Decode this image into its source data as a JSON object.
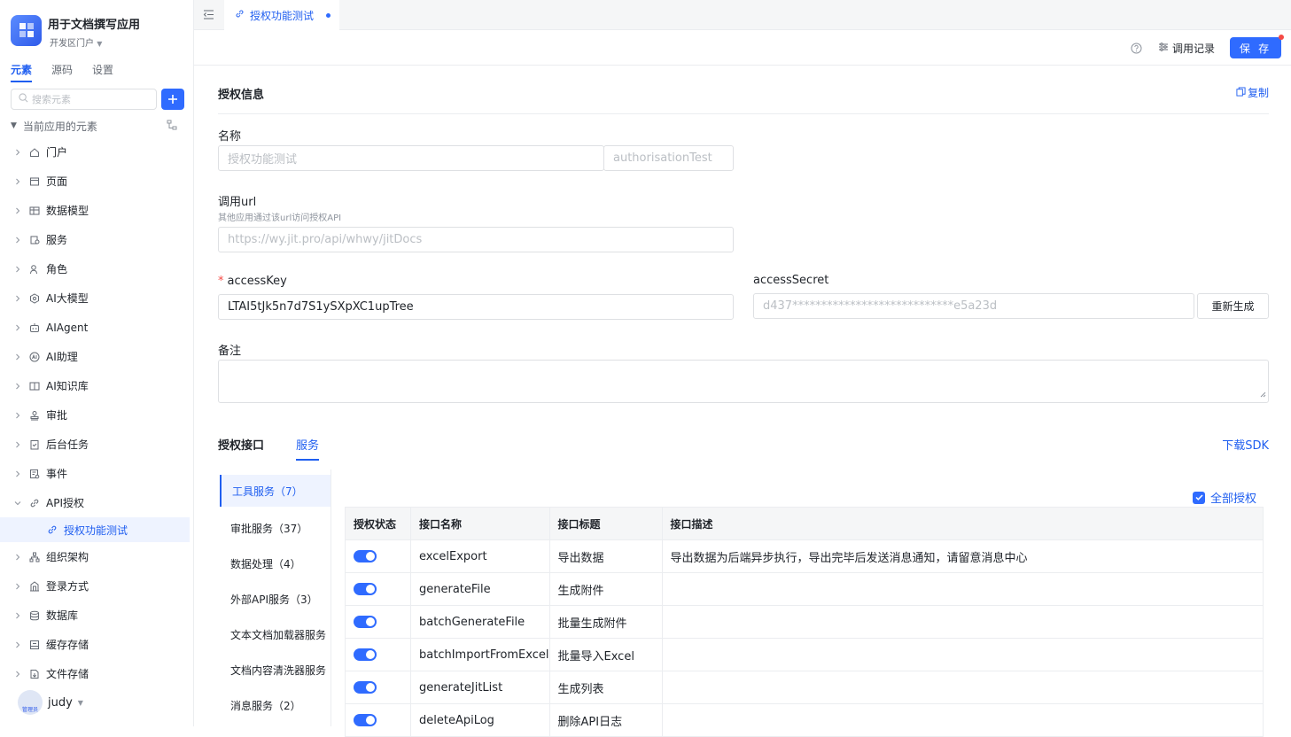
{
  "app": {
    "title": "用于文档撰写应用",
    "subtitle": "开发区门户"
  },
  "sidebar": {
    "tabs": [
      {
        "label": "元素"
      },
      {
        "label": "源码"
      },
      {
        "label": "设置"
      }
    ],
    "search_placeholder": "搜索元素",
    "group_label": "当前应用的元素",
    "items": [
      {
        "label": "门户",
        "icon": "home-icon"
      },
      {
        "label": "页面",
        "icon": "page-icon"
      },
      {
        "label": "数据模型",
        "icon": "table-icon"
      },
      {
        "label": "服务",
        "icon": "service-icon"
      },
      {
        "label": "角色",
        "icon": "role-icon"
      },
      {
        "label": "AI大模型",
        "icon": "ai-model-icon"
      },
      {
        "label": "AIAgent",
        "icon": "robot-icon"
      },
      {
        "label": "AI助理",
        "icon": "ai-assistant-icon"
      },
      {
        "label": "AI知识库",
        "icon": "book-icon"
      },
      {
        "label": "审批",
        "icon": "stamp-icon"
      },
      {
        "label": "后台任务",
        "icon": "task-icon"
      },
      {
        "label": "事件",
        "icon": "event-icon"
      },
      {
        "label": "API授权",
        "icon": "link-icon"
      }
    ],
    "active_sub": {
      "label": "授权功能测试",
      "icon": "link-icon"
    },
    "items_after": [
      {
        "label": "组织架构",
        "icon": "org-icon"
      },
      {
        "label": "登录方式",
        "icon": "login-icon"
      },
      {
        "label": "数据库",
        "icon": "database-icon"
      },
      {
        "label": "缓存存储",
        "icon": "cache-icon"
      },
      {
        "label": "文件存储",
        "icon": "file-icon"
      }
    ],
    "user": {
      "name": "judy",
      "role": "管理员"
    }
  },
  "tab": {
    "label": "授权功能测试"
  },
  "toolbar": {
    "log_label": "调用记录",
    "save_label": "保 存"
  },
  "form": {
    "section_title": "授权信息",
    "copy_label": "复制",
    "name_label": "名称",
    "name_value": "授权功能测试",
    "name_id": "authorisationTest",
    "url_label": "调用url",
    "url_hint": "其他应用通过该url访问授权API",
    "url_value": "https://wy.jit.pro/api/whwy/jitDocs",
    "access_key_label": "accessKey",
    "access_key_value": "LTAI5tJk5n7d7S1ySXpXC1upTree",
    "access_secret_label": "accessSecret",
    "access_secret_value": "d437****************************e5a23d",
    "regen_label": "重新生成",
    "remark_label": "备注",
    "remark_value": ""
  },
  "api": {
    "title": "授权接口",
    "tab_label": "服务",
    "sdk_label": "下载SDK",
    "all_auth_label": "全部授权",
    "categories": [
      "工具服务（7）",
      "审批服务（37）",
      "数据处理（4）",
      "外部API服务（3）",
      "文本文档加载器服务",
      "文档内容清洗器服务",
      "消息服务（2）"
    ],
    "columns": [
      "授权状态",
      "接口名称",
      "接口标题",
      "接口描述"
    ],
    "rows": [
      {
        "enabled": true,
        "name": "excelExport",
        "title": "导出数据",
        "desc": "导出数据为后端异步执行，导出完毕后发送消息通知，请留意消息中心"
      },
      {
        "enabled": true,
        "name": "generateFile",
        "title": "生成附件",
        "desc": ""
      },
      {
        "enabled": true,
        "name": "batchGenerateFile",
        "title": "批量生成附件",
        "desc": ""
      },
      {
        "enabled": true,
        "name": "batchImportFromExcel",
        "title": "批量导入Excel",
        "desc": ""
      },
      {
        "enabled": true,
        "name": "generateJitList",
        "title": "生成列表",
        "desc": ""
      },
      {
        "enabled": true,
        "name": "deleteApiLog",
        "title": "删除API日志",
        "desc": ""
      }
    ]
  },
  "colors": {
    "accent": "#2f6bff",
    "text": "#1f2329",
    "muted": "#646a73"
  }
}
